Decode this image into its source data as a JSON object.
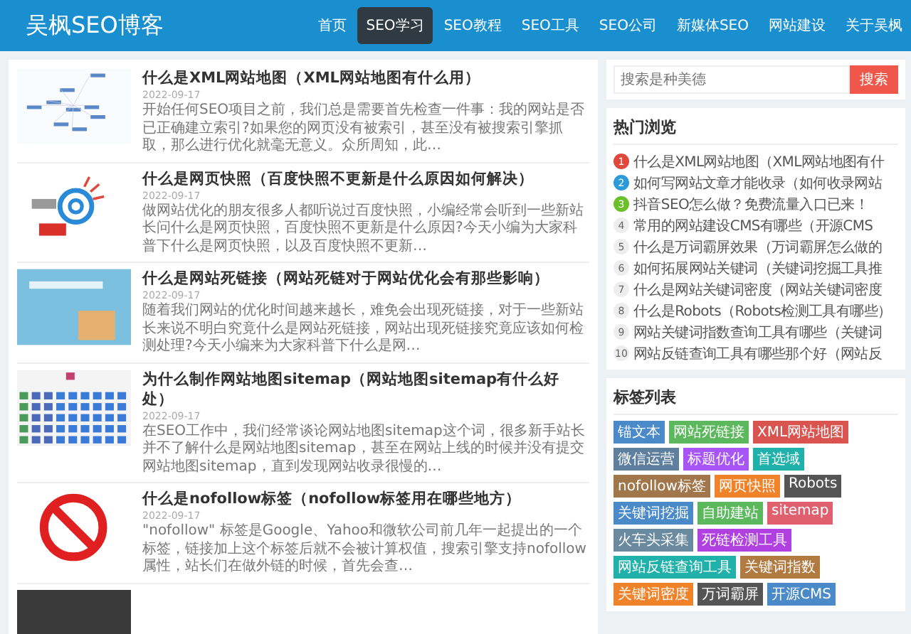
{
  "header": {
    "logo": "吴枫SEO博客",
    "nav": [
      {
        "label": "首页",
        "selected": false
      },
      {
        "label": "SEO学习",
        "selected": true
      },
      {
        "label": "SEO教程",
        "selected": false
      },
      {
        "label": "SEO工具",
        "selected": false
      },
      {
        "label": "SEO公司",
        "selected": false
      },
      {
        "label": "新媒体SEO",
        "selected": false
      },
      {
        "label": "网站建设",
        "selected": false
      },
      {
        "label": "关于吴枫",
        "selected": false
      }
    ]
  },
  "articles": [
    {
      "kind": "mindmap",
      "title": "什么是XML网站地图（XML网站地图有什么用）",
      "date": "2022-09-17",
      "excerpt": "开始任何SEO项目之前，我们总是需要首先检查一件事：我的网站是否已正确建立索引?如果您的网页没有被索引，甚至没有被搜索引擎抓取，那么进行优化就毫无意义。众所周知，此…"
    },
    {
      "kind": "snapshot",
      "title": "什么是网页快照（百度快照不更新是什么原因如何解决）",
      "date": "2022-09-17",
      "excerpt": "做网站优化的朋友很多人都听说过百度快照，小编经常会听到一些新站长问什么是网页快照，百度快照不更新是什么原因?今天小编为大家科普下什么是网页快照，以及百度快照不更新…"
    },
    {
      "kind": "box",
      "title": "什么是网站死链接（网站死链对于网站优化会有那些影响）",
      "date": "2022-09-17",
      "excerpt": "随着我们网站的优化时间越来越长，难免会出现死链接，对于一些新站长来说不明白究竟什么是网站死链接，网站出现死链接究竟应该如何检测处理?今天小编来为大家科普下什么是网…"
    },
    {
      "kind": "sitemap",
      "title": "为什么制作网站地图sitemap（网站地图sitemap有什么好处）",
      "date": "2022-09-17",
      "excerpt": "在SEO工作中，我们经常谈论网站地图sitemap这个词，很多新手站长并不了解什么是网站地图sitemap，甚至在网站上线的时候并没有提交网站地图sitemap，直到发现网站收录很慢的…"
    },
    {
      "kind": "nofollow",
      "title": "什么是nofollow标签（nofollow标签用在哪些地方）",
      "date": "2022-09-17",
      "excerpt": "\"nofollow\" 标签是Google、Yahoo和微软公司前几年一起提出的一个标签，链接加上这个标签后就不会被计算权值，搜索引擎支持nofollow属性，站长们在做外链的时候，首先会查…"
    },
    {
      "kind": "dark"
    }
  ],
  "search": {
    "placeholder": "搜索是种美德",
    "button": "搜索"
  },
  "popular": {
    "title": "热门浏览",
    "items": [
      {
        "rank": "1",
        "color": "#e0483e",
        "text": "什么是XML网站地图（XML网站地图有什"
      },
      {
        "rank": "2",
        "color": "#2a9ad8",
        "text": "如何写网站文章才能收录（如何收录网站"
      },
      {
        "rank": "3",
        "color": "#6ac02a",
        "text": "抖音SEO怎么做？免费流量入口已来！"
      },
      {
        "rank": "4",
        "color": "#eeeeee",
        "text": "常用的网站建设CMS有哪些（开源CMS"
      },
      {
        "rank": "5",
        "color": "#eeeeee",
        "text": "什么是万词霸屏效果（万词霸屏怎么做的"
      },
      {
        "rank": "6",
        "color": "#eeeeee",
        "text": "如何拓展网站关键词（关键词挖掘工具推"
      },
      {
        "rank": "7",
        "color": "#eeeeee",
        "text": "什么是网站关键词密度（网站关键词密度"
      },
      {
        "rank": "8",
        "color": "#eeeeee",
        "text": "什么是Robots（Robots检测工具有哪些）"
      },
      {
        "rank": "9",
        "color": "#eeeeee",
        "text": "网站关键词指数查询工具有哪些（关键词"
      },
      {
        "rank": "10",
        "color": "#eeeeee",
        "text": "网站反链查询工具有哪些那个好（网站反"
      }
    ]
  },
  "tags": {
    "title": "标签列表",
    "items": [
      {
        "label": "锚文本",
        "color": "#4a8ac9"
      },
      {
        "label": "网站死链接",
        "color": "#5cb85c"
      },
      {
        "label": "XML网站地图",
        "color": "#d9534f"
      },
      {
        "label": "微信运营",
        "color": "#5f7f9f"
      },
      {
        "label": "标题优化",
        "color": "#a855f7"
      },
      {
        "label": "首选域",
        "color": "#20b2aa"
      },
      {
        "label": "nofollow标签",
        "color": "#a0764a"
      },
      {
        "label": "网页快照",
        "color": "#f0822a"
      },
      {
        "label": "Robots",
        "color": "#555555"
      },
      {
        "label": "关键词挖掘",
        "color": "#4a8ac9"
      },
      {
        "label": "自助建站",
        "color": "#5cb85c"
      },
      {
        "label": "sitemap",
        "color": "#e06070"
      },
      {
        "label": "火车头采集",
        "color": "#6a8aa0"
      },
      {
        "label": "死链检测工具",
        "color": "#b040e0"
      },
      {
        "label": "网站反链查询工具",
        "color": "#20b2aa"
      },
      {
        "label": "关键词指数",
        "color": "#b07a40"
      },
      {
        "label": "关键词密度",
        "color": "#f0822a"
      },
      {
        "label": "万词霸屏",
        "color": "#555555"
      },
      {
        "label": "开源CMS",
        "color": "#4a8ac9"
      }
    ]
  }
}
